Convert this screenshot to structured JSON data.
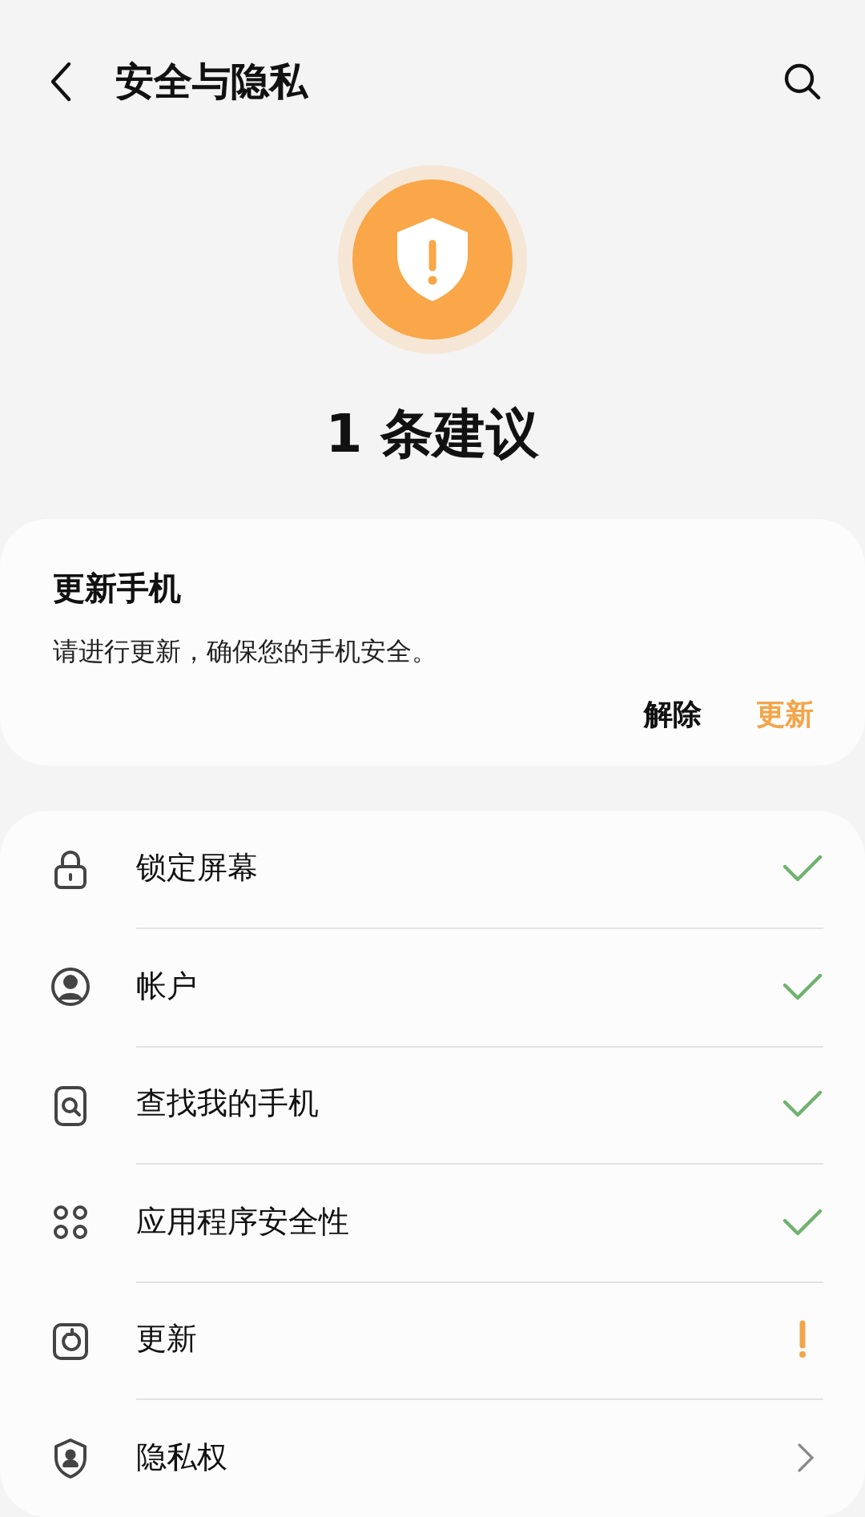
{
  "header": {
    "title": "安全与隐私"
  },
  "summary": {
    "text": "1 条建议"
  },
  "suggestion": {
    "title": "更新手机",
    "text": "请进行更新，确保您的手机安全。",
    "actions": [
      {
        "label": "解除",
        "primary": false
      },
      {
        "label": "更新",
        "primary": true
      }
    ]
  },
  "items": [
    {
      "label": "锁定屏幕",
      "kind": "ok"
    },
    {
      "label": "帐户",
      "kind": "ok"
    },
    {
      "label": "查找我的手机",
      "kind": "ok"
    },
    {
      "label": "应用程序安全性",
      "kind": "ok"
    },
    {
      "label": "更新",
      "kind": "warn"
    },
    {
      "label": "隐私权",
      "kind": "link"
    }
  ]
}
